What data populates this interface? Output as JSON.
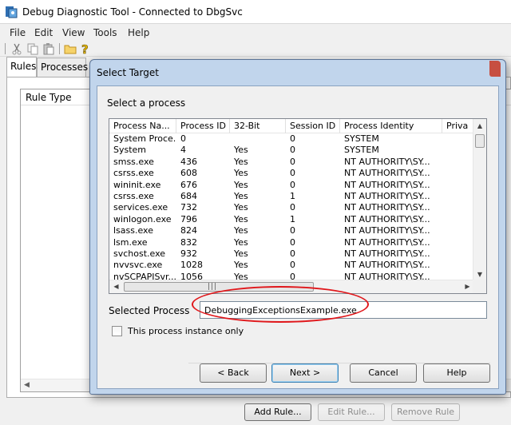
{
  "window": {
    "title": "Debug Diagnostic Tool - Connected to DbgSvc",
    "icon": "debug-diag-app-icon"
  },
  "menu": [
    "File",
    "Edit",
    "View",
    "Tools",
    "Help"
  ],
  "toolbar": {
    "icons": [
      "cut-icon",
      "copy-icon",
      "paste-icon",
      "open-folder-icon",
      "help-icon"
    ]
  },
  "tabs": [
    {
      "label": "Rules",
      "active": true
    },
    {
      "label": "Processes",
      "active": false
    }
  ],
  "rules_panel": {
    "column_header": "Rule Type",
    "buttons": {
      "add_rule": "Add Rule...",
      "edit_rule": "Edit Rule...",
      "remove_rule": "Remove Rule"
    }
  },
  "dialog": {
    "title": "Select Target",
    "select_process_label": "Select a process",
    "columns": [
      "Process Na...",
      "Process ID",
      "32-Bit",
      "Session ID",
      "Process Identity",
      "Priva"
    ],
    "rows": [
      {
        "name": "System Proce...",
        "pid": "0",
        "bit32": "",
        "session": "0",
        "identity": "SYSTEM"
      },
      {
        "name": "System",
        "pid": "4",
        "bit32": "Yes",
        "session": "0",
        "identity": "SYSTEM"
      },
      {
        "name": "smss.exe",
        "pid": "436",
        "bit32": "Yes",
        "session": "0",
        "identity": "NT AUTHORITY\\SY..."
      },
      {
        "name": "csrss.exe",
        "pid": "608",
        "bit32": "Yes",
        "session": "0",
        "identity": "NT AUTHORITY\\SY..."
      },
      {
        "name": "wininit.exe",
        "pid": "676",
        "bit32": "Yes",
        "session": "0",
        "identity": "NT AUTHORITY\\SY..."
      },
      {
        "name": "csrss.exe",
        "pid": "684",
        "bit32": "Yes",
        "session": "1",
        "identity": "NT AUTHORITY\\SY..."
      },
      {
        "name": "services.exe",
        "pid": "732",
        "bit32": "Yes",
        "session": "0",
        "identity": "NT AUTHORITY\\SY..."
      },
      {
        "name": "winlogon.exe",
        "pid": "796",
        "bit32": "Yes",
        "session": "1",
        "identity": "NT AUTHORITY\\SY..."
      },
      {
        "name": "lsass.exe",
        "pid": "824",
        "bit32": "Yes",
        "session": "0",
        "identity": "NT AUTHORITY\\SY..."
      },
      {
        "name": "lsm.exe",
        "pid": "832",
        "bit32": "Yes",
        "session": "0",
        "identity": "NT AUTHORITY\\SY..."
      },
      {
        "name": "svchost.exe",
        "pid": "932",
        "bit32": "Yes",
        "session": "0",
        "identity": "NT AUTHORITY\\SY..."
      },
      {
        "name": "nvvsvc.exe",
        "pid": "1028",
        "bit32": "Yes",
        "session": "0",
        "identity": "NT AUTHORITY\\SY..."
      },
      {
        "name": "nvSCPAPISvr...",
        "pid": "1056",
        "bit32": "Yes",
        "session": "0",
        "identity": "NT AUTHORITY\\SY..."
      }
    ],
    "selected_process_label": "Selected Process",
    "selected_process_value": "DebuggingExceptionsExample.exe",
    "instance_only_label": "This process instance only",
    "instance_only_checked": false,
    "buttons": {
      "back": "< Back",
      "next": "Next >",
      "cancel": "Cancel",
      "help": "Help"
    },
    "highlight_color": "#e0171b"
  }
}
